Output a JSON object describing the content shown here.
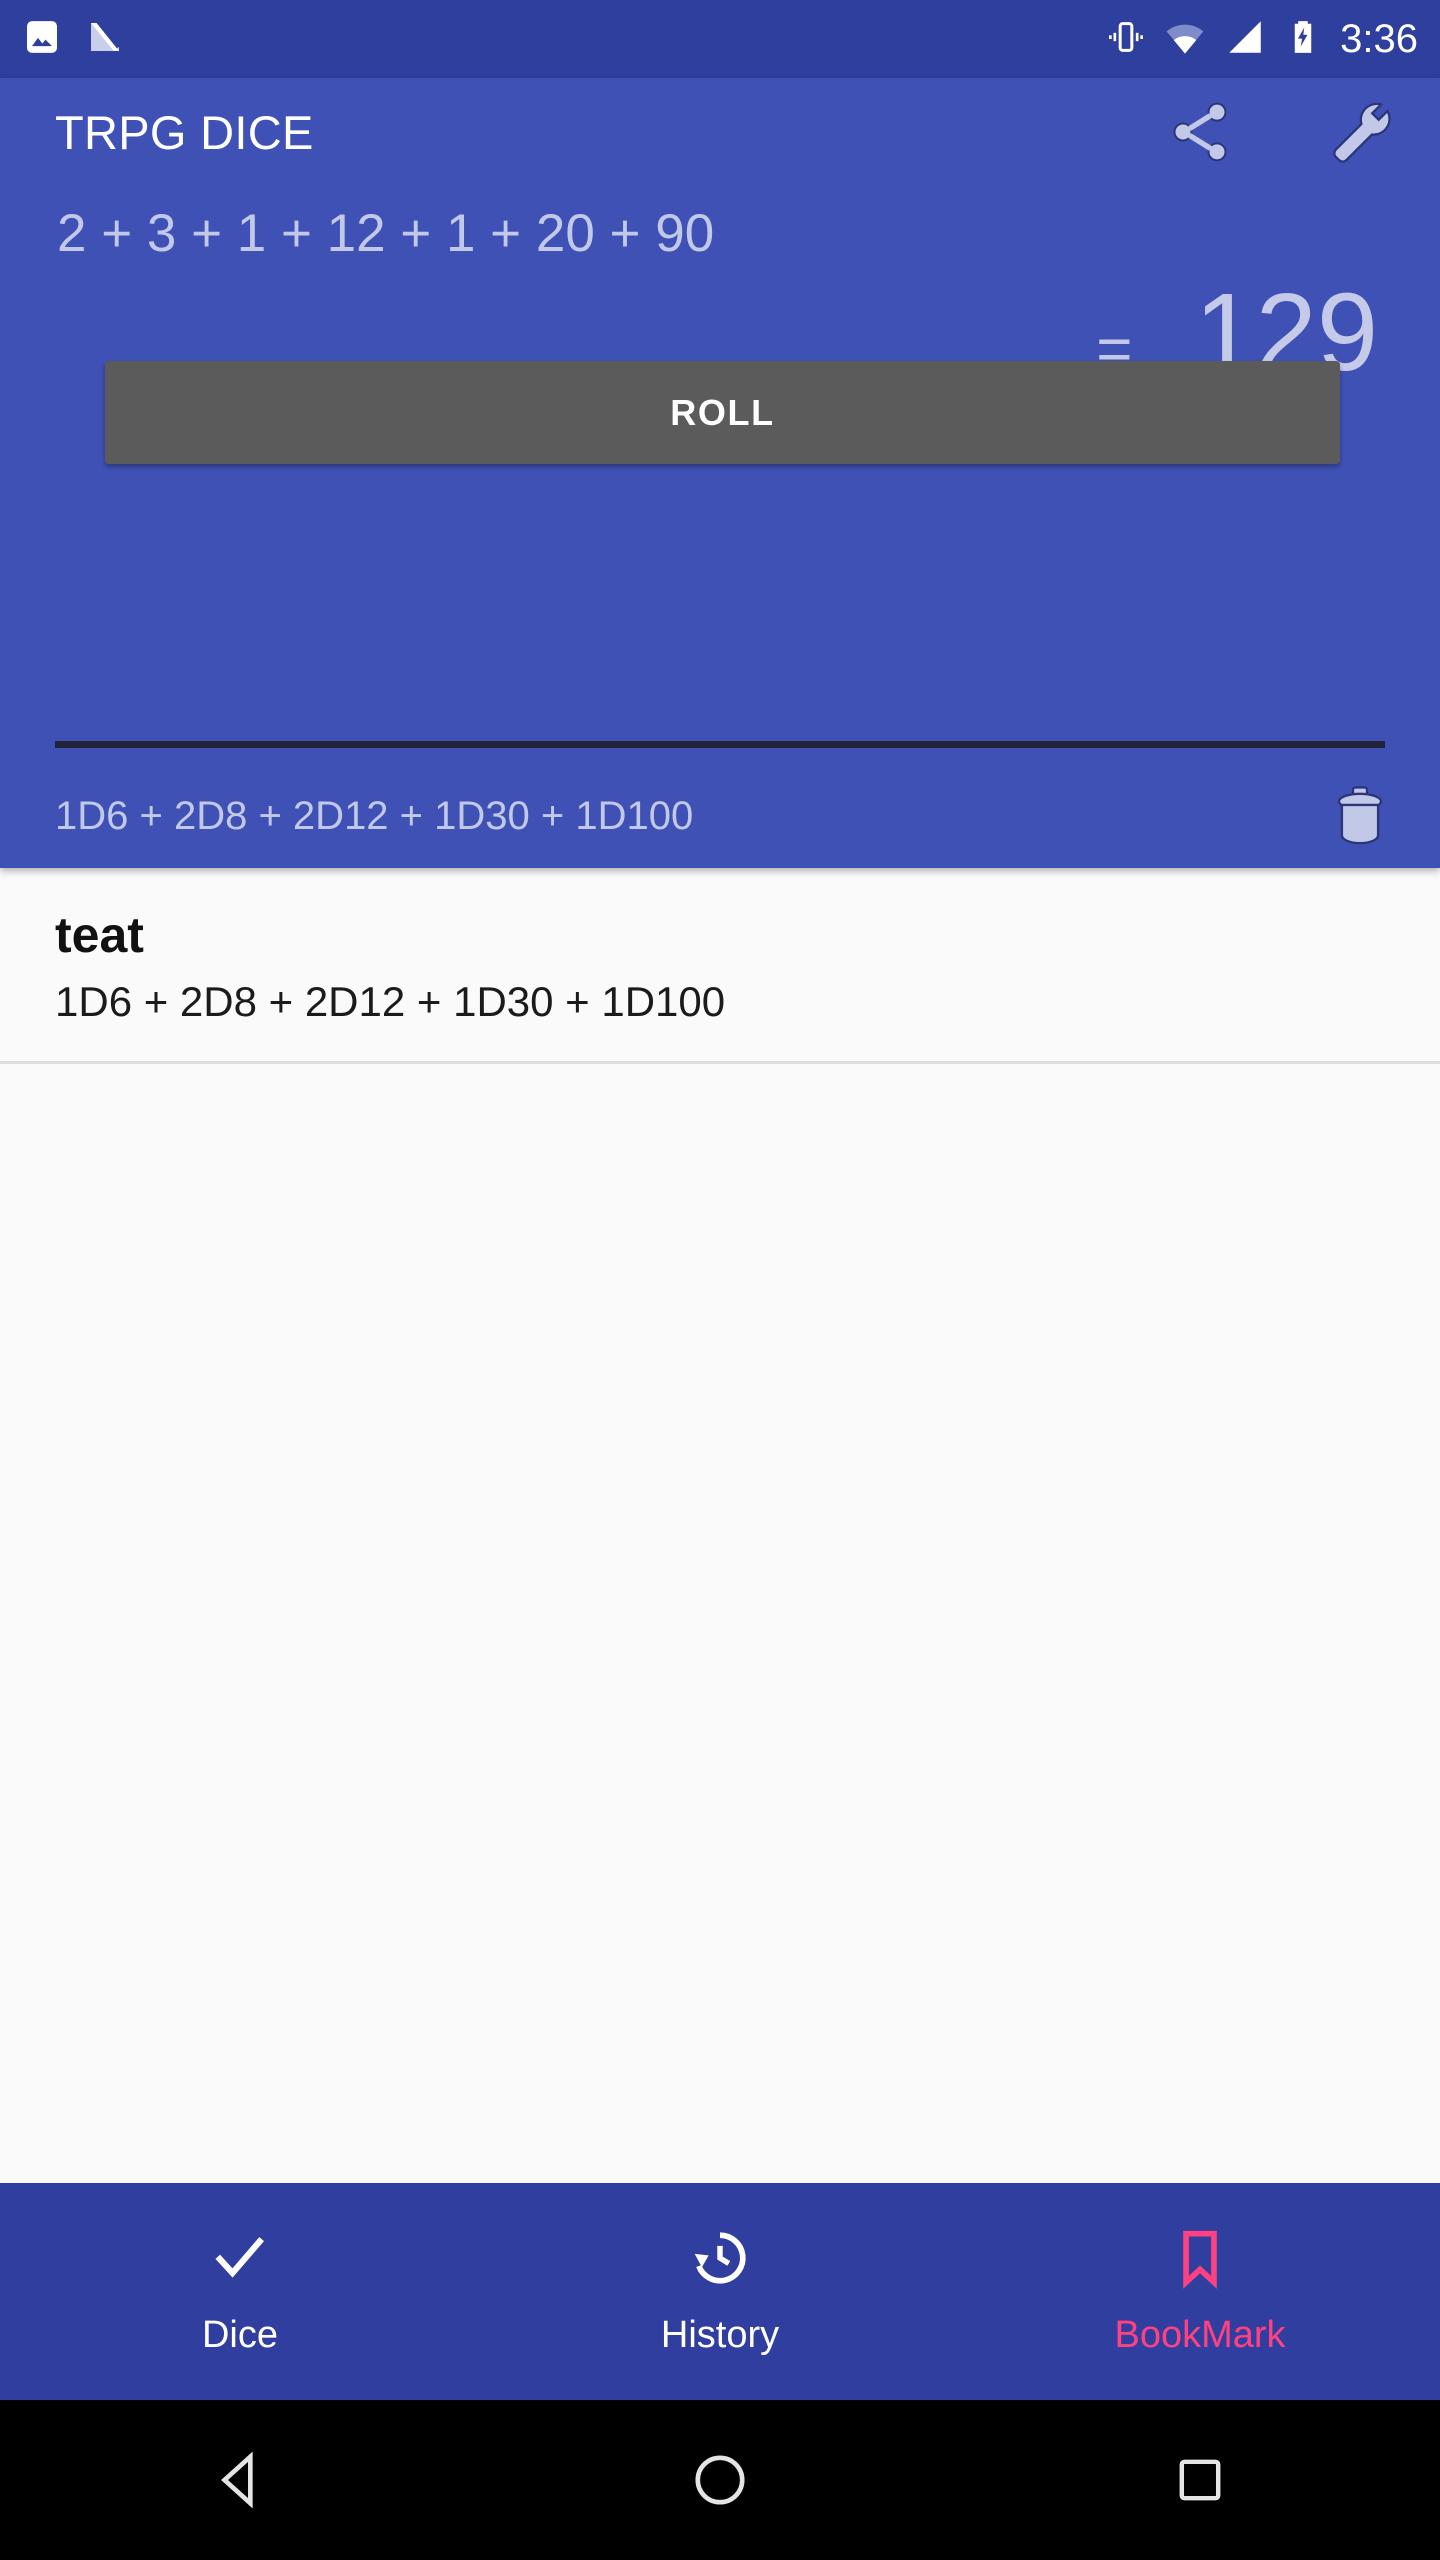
{
  "status_bar": {
    "time": "3:36",
    "left_icons": [
      "screenshot-image-icon",
      "android-nougat-icon"
    ],
    "right_icons": [
      "vibrate-icon",
      "wifi-icon",
      "cell-signal-icon",
      "battery-charging-icon"
    ],
    "background_color": "#2f3f9e"
  },
  "header": {
    "title": "TRPG DICE",
    "share_icon": "share-icon",
    "settings_icon": "wrench-icon",
    "background_color": "#3f51b5",
    "text_color": "#c2c9e8"
  },
  "result": {
    "expression": "2 + 3 + 1 + 12 + 1 + 20 + 90",
    "equals_sign": "=",
    "total": "129",
    "total_color": "#c5cae9"
  },
  "roll": {
    "label": "ROLL",
    "button_color": "#5b5b5b"
  },
  "formula": {
    "text": "1D6 + 2D8 + 2D12 + 1D30 + 1D100",
    "delete_icon": "trash-icon"
  },
  "bookmarks": [
    {
      "title": "teat",
      "formula": "1D6 + 2D8 + 2D12 + 1D30 + 1D100"
    }
  ],
  "bottom_nav": {
    "active_color": "#ff4081",
    "inactive_color": "#ffffff",
    "background_color": "#303f9f",
    "items": [
      {
        "label": "Dice",
        "icon": "check-icon",
        "active": false
      },
      {
        "label": "History",
        "icon": "history-icon",
        "active": false
      },
      {
        "label": "BookMark",
        "icon": "bookmark-icon",
        "active": true
      }
    ]
  },
  "system_nav": {
    "back": "back-triangle-icon",
    "home": "home-circle-icon",
    "recents": "recents-square-icon"
  }
}
